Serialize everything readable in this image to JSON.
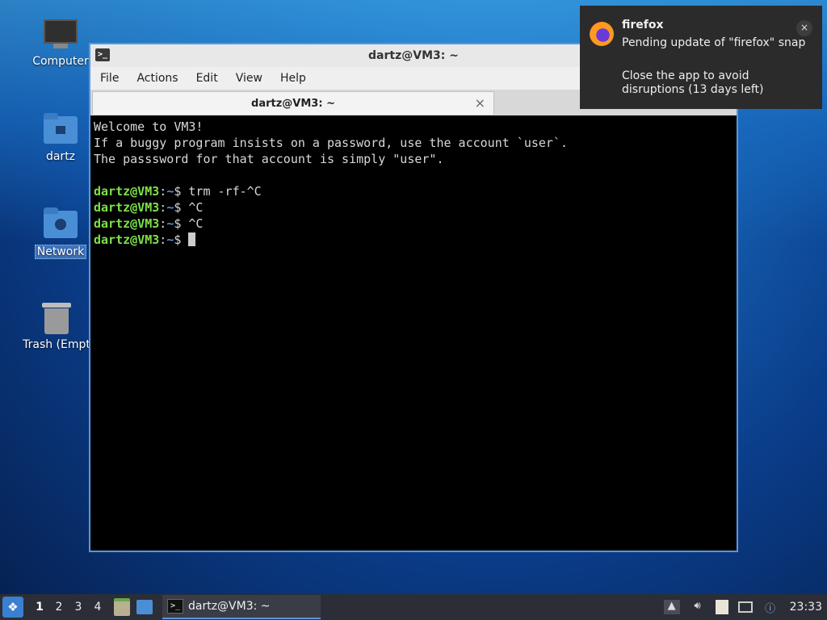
{
  "desktop": {
    "icons": [
      {
        "label": "Computer"
      },
      {
        "label": "dartz"
      },
      {
        "label": "Network"
      },
      {
        "label": "Trash (Empt"
      }
    ]
  },
  "window": {
    "title": "dartz@VM3: ~",
    "menu": [
      "File",
      "Actions",
      "Edit",
      "View",
      "Help"
    ],
    "tab": {
      "label": "dartz@VM3: ~",
      "close": "×"
    },
    "terminal": {
      "lines": [
        "Welcome to VM3!",
        "If a buggy program insists on a password, use the account `user`.",
        "The passsword for that account is simply \"user\"."
      ],
      "prompt_user": "dartz@VM3",
      "prompt_sep": ":",
      "prompt_path": "~",
      "prompt_end": "$ ",
      "commands": [
        "trm -rf-^C",
        "^C",
        "^C",
        ""
      ]
    }
  },
  "notification": {
    "app": "firefox",
    "line1": "Pending update of \"firefox\" snap",
    "line2": "Close the app to avoid disruptions (13 days left)",
    "close": "×"
  },
  "taskbar": {
    "workspaces": [
      "1",
      "2",
      "3",
      "4"
    ],
    "task": "dartz@VM3: ~",
    "clock": "23:33"
  },
  "colors": {
    "prompt_user": "#7ee04a",
    "prompt_path": "#5a8fe0",
    "window_border": "#5a95dc"
  }
}
